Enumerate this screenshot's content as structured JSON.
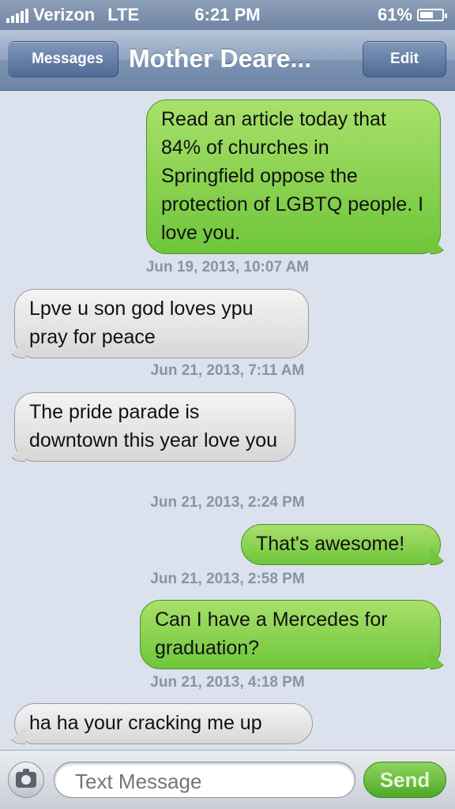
{
  "status_bar": {
    "carrier": "Verizon",
    "network": "LTE",
    "time": "6:21 PM",
    "battery": "61%",
    "battery_level": 0.61
  },
  "nav": {
    "back_label": "Messages",
    "title": "Mother Deare...",
    "edit_label": "Edit"
  },
  "messages": [
    {
      "direction": "out",
      "text": "Read an article today that 84% of churches in Springfield oppose the protection of LGBTQ people. I love you."
    },
    {
      "timestamp": "Jun 19, 2013, 10:07 AM"
    },
    {
      "direction": "in",
      "text": "Lpve u son god loves ypu pray for peace"
    },
    {
      "timestamp": "Jun 21, 2013, 7:11 AM"
    },
    {
      "direction": "in",
      "text": "The pride parade is downtown this year love you"
    },
    {
      "timestamp": "Jun 21, 2013, 2:24 PM"
    },
    {
      "direction": "out",
      "text": "That's awesome!"
    },
    {
      "timestamp": "Jun 21, 2013, 2:58 PM"
    },
    {
      "direction": "out",
      "text": "Can I have a Mercedes for graduation?"
    },
    {
      "timestamp": "Jun 21, 2013, 4:18 PM"
    },
    {
      "direction": "in",
      "text": "ha ha your cracking me up"
    }
  ],
  "input_bar": {
    "placeholder": "Text Message",
    "send_label": "Send",
    "camera_icon": "camera-icon"
  },
  "colors": {
    "outgoing_bubble": "#7fcd45",
    "incoming_bubble": "#e4e4e4",
    "background": "#dbe2ed",
    "nav_bar": "#7c92b2"
  }
}
